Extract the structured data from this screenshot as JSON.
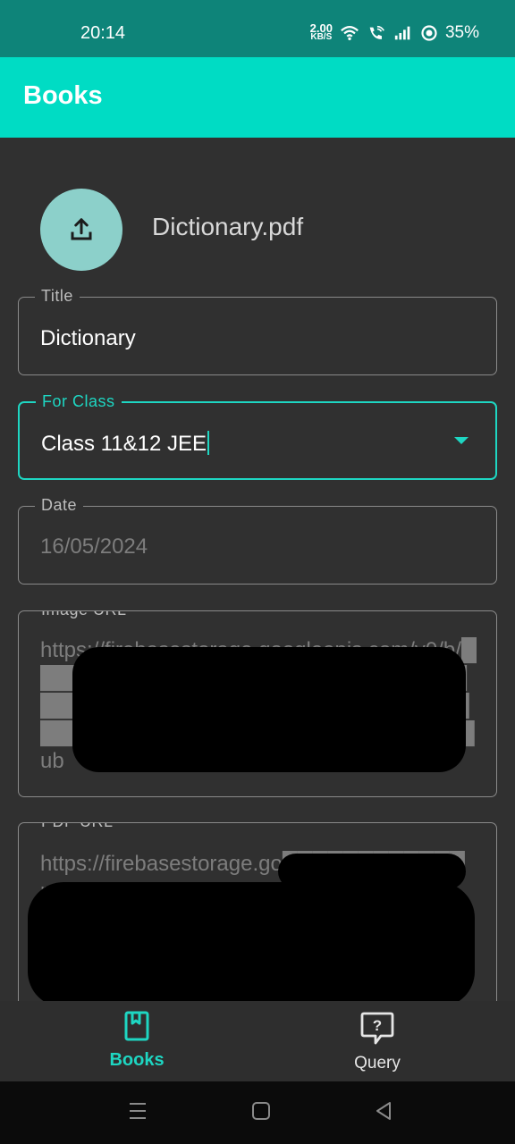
{
  "status_bar": {
    "time": "20:14",
    "net_speed_value": "2.00",
    "net_speed_unit": "KB/S",
    "battery": "35%",
    "icons": [
      "wifi-icon",
      "wifi-call-icon",
      "signal-icon",
      "battery-ring-icon"
    ]
  },
  "app_bar": {
    "title": "Books"
  },
  "upload": {
    "icon": "upload-icon",
    "file_name": "Dictionary.pdf"
  },
  "fields": {
    "title": {
      "label": "Title",
      "value": "Dictionary"
    },
    "for_class": {
      "label": "For Class",
      "value": "Class 11&12 JEE"
    },
    "date": {
      "label": "Date",
      "value": "16/05/2024"
    },
    "image_url": {
      "label": "Image URL",
      "value": "https://firebasestorage.googleapis.com/v0/b/████████████/o/im████████████████████ent%████████████████████████7b██████████████████████ub"
    },
    "pdf_url": {
      "label": "PDF URL",
      "value": "https://firebasestorage.go████████████m"
    }
  },
  "bottom_nav": {
    "items": [
      {
        "label": "Books",
        "icon": "book-icon",
        "active": true
      },
      {
        "label": "Query",
        "icon": "question-bubble-icon",
        "active": false
      }
    ]
  },
  "colors": {
    "accent": "#1ed6c2",
    "app_bar": "#00dcc4",
    "status_bar": "#0e8479",
    "background": "#303030"
  }
}
